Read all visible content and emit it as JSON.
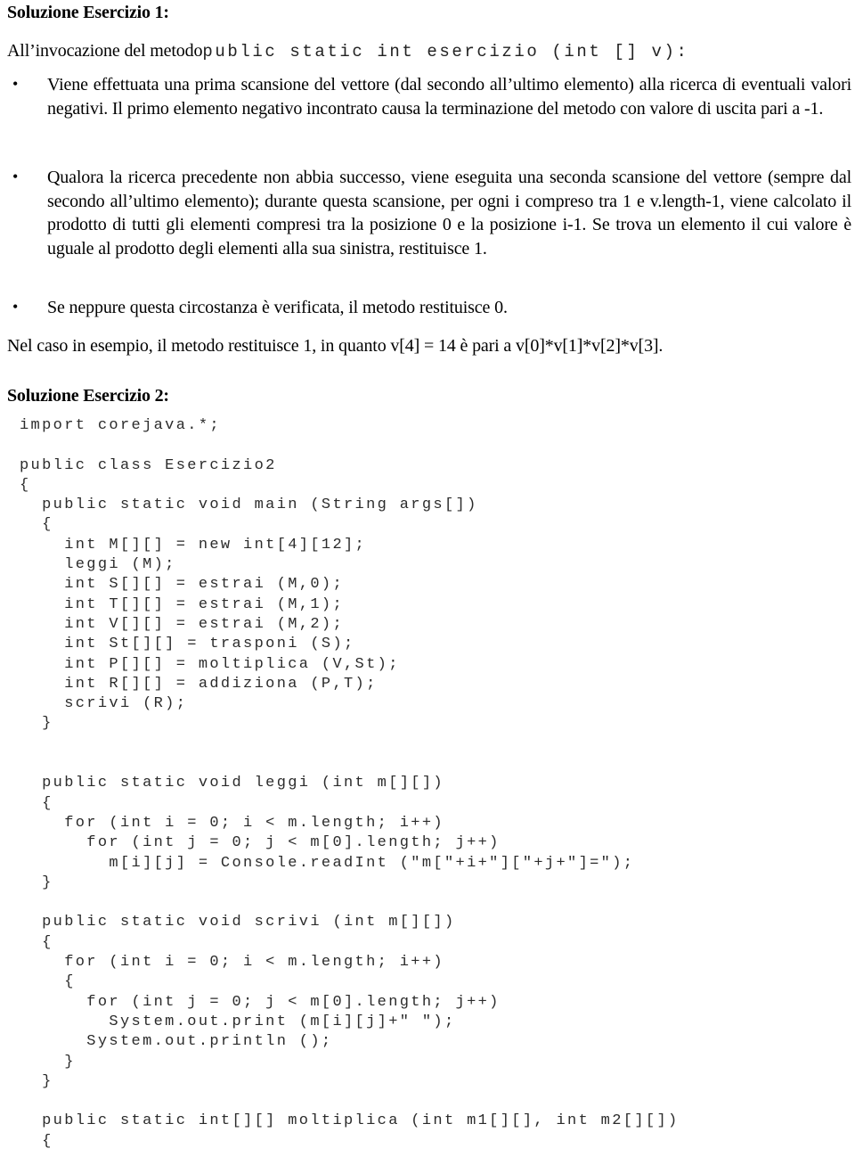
{
  "document": {
    "heading1": "Soluzione Esercizio 1:",
    "lead_prefix": "All’invocazione del metodo",
    "lead_code": "public static int esercizio (int [] v):",
    "bullets": [
      "Viene effettuata una prima scansione del vettore (dal secondo all’ultimo elemento) alla ricerca di eventuali valori negativi. Il primo elemento negativo incontrato causa la terminazione del metodo con valore di uscita pari a -1.",
      "Qualora la ricerca precedente non abbia successo, viene eseguita una seconda scansione del vettore (sempre dal secondo all’ultimo elemento); durante questa scansione, per ogni i compreso tra 1 e v.length-1, viene calcolato il prodotto di tutti gli elementi compresi tra la posizione 0 e la posizione i-1. Se trova un elemento il cui valore è uguale al prodotto degli elementi alla sua sinistra, restituisce 1.",
      "Se neppure questa circostanza è verificata, il metodo restituisce 0."
    ],
    "closing_paragraph": "Nel caso in esempio, il metodo restituisce 1, in quanto v[4] = 14 è pari a v[0]*v[1]*v[2]*v[3].",
    "heading2": "Soluzione Esercizio 2:",
    "code_listing": "import corejava.*;\n\npublic class Esercizio2\n{\n  public static void main (String args[])\n  {\n    int M[][] = new int[4][12];\n    leggi (M);\n    int S[][] = estrai (M,0);\n    int T[][] = estrai (M,1);\n    int V[][] = estrai (M,2);\n    int St[][] = trasponi (S);\n    int P[][] = moltiplica (V,St);\n    int R[][] = addiziona (P,T);\n    scrivi (R);\n  }\n\n\n  public static void leggi (int m[][])\n  {\n    for (int i = 0; i < m.length; i++)\n      for (int j = 0; j < m[0].length; j++)\n        m[i][j] = Console.readInt (\"m[\"+i+\"][\"+j+\"]=\");\n  }\n\n  public static void scrivi (int m[][])\n  {\n    for (int i = 0; i < m.length; i++)\n    {\n      for (int j = 0; j < m[0].length; j++)\n        System.out.print (m[i][j]+\" \");\n      System.out.println ();\n    }\n  }\n\n  public static int[][] moltiplica (int m1[][], int m2[][])\n  {"
  }
}
